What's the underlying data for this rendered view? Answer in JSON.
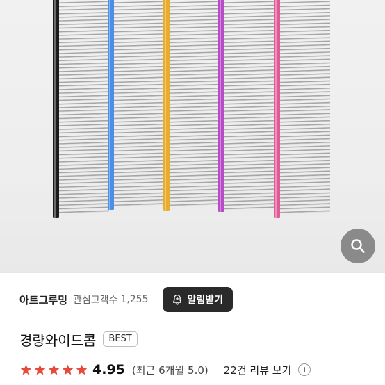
{
  "product_image": {
    "comb_colors": [
      "#1b1b1b",
      "#4a8ee8",
      "#e7ad2f",
      "#b84cc8",
      "#e05a95"
    ]
  },
  "zoom_button": {
    "icon": "search-icon"
  },
  "store": {
    "name": "아트그루밍",
    "interest_label": "관심고객수",
    "interest_count": "1,255",
    "notify_button": {
      "icon": "bell-plus-icon",
      "label": "알림받기"
    }
  },
  "product": {
    "title": "경량와이드콤",
    "badge": "BEST"
  },
  "rating": {
    "stars": 5,
    "value": "4.95",
    "recent": "(최근 6개월 5.0)",
    "review_link": "22건 리뷰 보기",
    "info_icon": "i",
    "star_color": "#e54b3c"
  }
}
